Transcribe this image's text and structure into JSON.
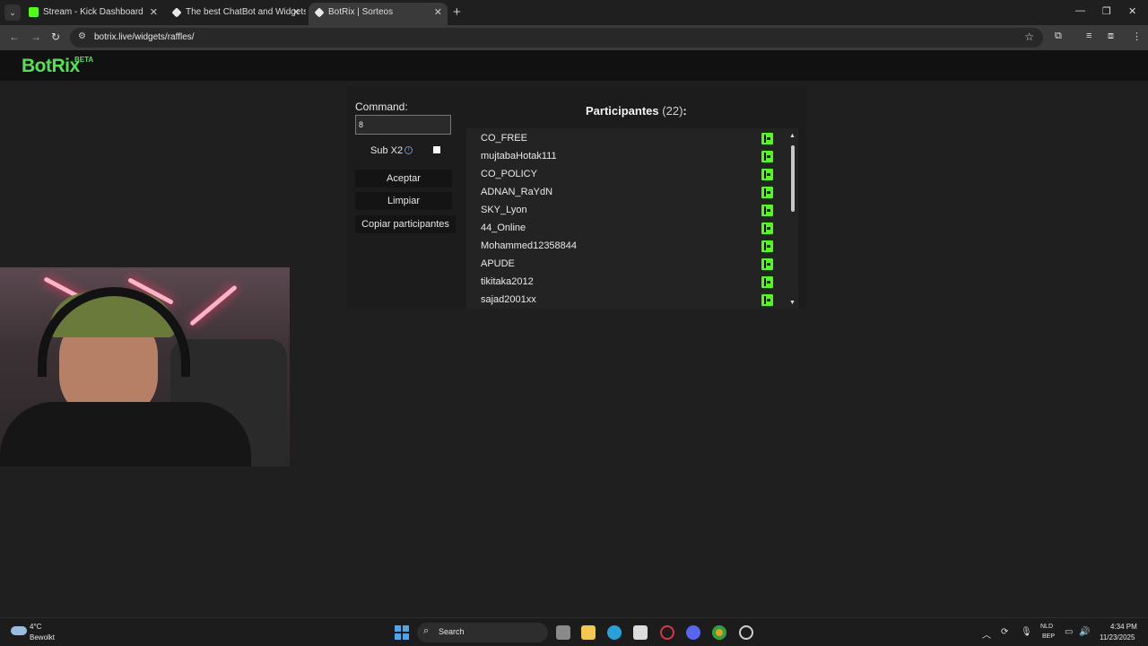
{
  "browser": {
    "tabs": [
      {
        "title": "Stream - Kick Dashboard",
        "favicon_color": "#53fc18"
      },
      {
        "title": "The best ChatBot and Widgets",
        "favicon_color": "#e8e8e8"
      },
      {
        "title": "BotRix | Sorteos",
        "favicon_color": "#e8e8e8"
      }
    ],
    "active_tab": 2,
    "url": "botrix.live/widgets/raffles/"
  },
  "site": {
    "logo": "BotRix",
    "badge": "BETA",
    "brand_color": "#52e252"
  },
  "raffle": {
    "command_label": "Command:",
    "command_value": "8",
    "sub_label": "Sub X2",
    "sub_checked": false,
    "accept_label": "Aceptar",
    "clear_label": "Limpiar",
    "copy_label": "Copiar participantes",
    "participants_title": "Participantes",
    "participants_count": "(22)",
    "participants_suffix": ":",
    "participants": [
      "CO_FREE",
      "mujtabaHotak111",
      "CO_POLICY",
      "ADNAN_RaYdN",
      "SKY_Lyon",
      "44_Online",
      "Mohammed12358844",
      "APUDE",
      "tikitaka2012",
      "sajad2001xx"
    ],
    "platform_icon": "kick-icon",
    "platform_color": "#53fc18"
  },
  "taskbar": {
    "weather_temp": "4°C",
    "weather_desc": "Bewolkt",
    "search_label": "Search",
    "lang_line1": "NLD",
    "lang_line2": "BEP",
    "time": "4:34 PM",
    "date": "11/23/2025"
  }
}
